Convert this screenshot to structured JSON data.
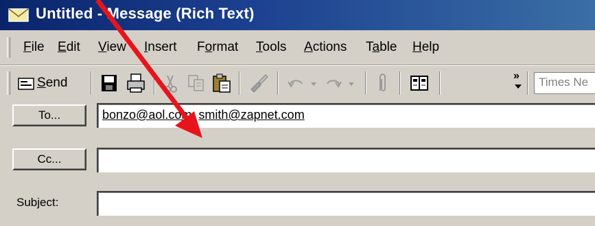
{
  "window": {
    "title": "Untitled - Message (Rich Text)"
  },
  "menu": [
    {
      "label": "File",
      "u": "F",
      "rest": "ile"
    },
    {
      "label": "Edit",
      "u": "E",
      "rest": "dit"
    },
    {
      "label": "View",
      "u": "V",
      "rest": "iew"
    },
    {
      "label": "Insert",
      "u": "I",
      "rest": "nsert"
    },
    {
      "label": "Format",
      "pre": "F",
      "u": "o",
      "rest": "rmat"
    },
    {
      "label": "Tools",
      "u": "T",
      "rest": "ools"
    },
    {
      "label": "Actions",
      "u": "A",
      "rest": "ctions"
    },
    {
      "label": "Table",
      "pre": "T",
      "u": "a",
      "rest": "ble"
    },
    {
      "label": "Help",
      "u": "H",
      "rest": "elp"
    }
  ],
  "toolbar": {
    "send_label": "Send",
    "send_u": "S",
    "send_rest": "end",
    "font_name": "Times Ne",
    "more_glyph": "»"
  },
  "fields": {
    "to_button": "To...",
    "to_value_1": "bonzo@aol.com",
    "to_sep": "; ",
    "to_value_2": "smith@zapnet.com",
    "cc_button": "Cc...",
    "cc_value": "",
    "subject_label": "Subject:",
    "subject_value": ""
  },
  "colors": {
    "titlebar_start": "#0a246a",
    "titlebar_end": "#3a6ea5",
    "annotation_arrow": "#e8141c"
  },
  "icons": [
    "envelope-icon",
    "send-icon",
    "save-icon",
    "print-icon",
    "cut-icon",
    "copy-icon",
    "paste-icon",
    "format-painter-icon",
    "undo-icon",
    "redo-icon",
    "attach-icon",
    "address-book-icon",
    "toolbar-overflow-icon"
  ]
}
